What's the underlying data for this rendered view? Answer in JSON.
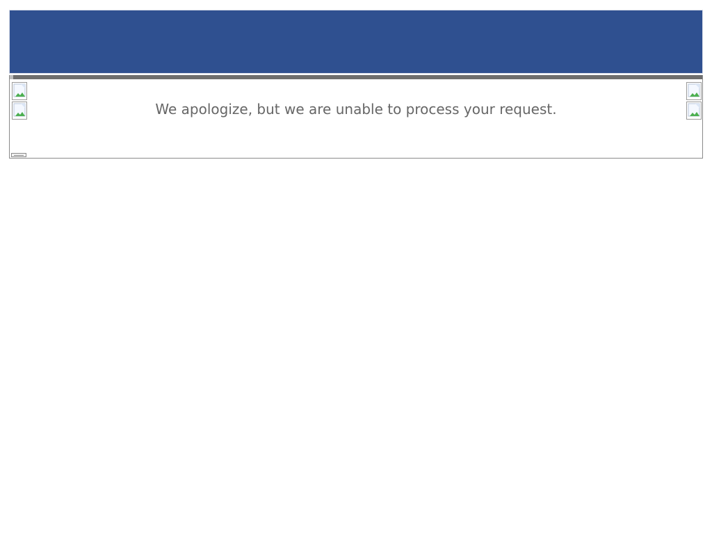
{
  "header": {
    "color": "#2f5090"
  },
  "content": {
    "message": "We apologize, but we are unable to process your request."
  },
  "images": [
    {
      "name": "broken-image-icon"
    },
    {
      "name": "broken-image-icon"
    },
    {
      "name": "broken-image-icon"
    },
    {
      "name": "broken-image-icon"
    }
  ]
}
